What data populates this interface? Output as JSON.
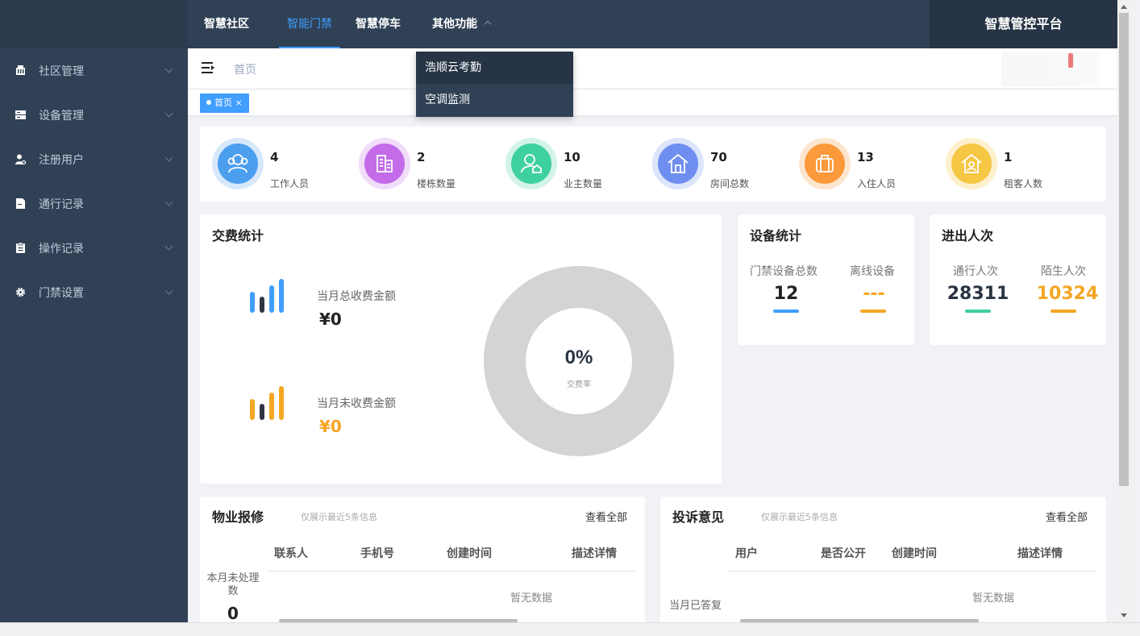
{
  "nav": {
    "tabs": [
      {
        "label": "智慧社区"
      },
      {
        "label": "智能门禁"
      },
      {
        "label": "智慧停车"
      },
      {
        "label": "其他功能"
      }
    ],
    "platform_title": "智慧管控平台",
    "dropdown": [
      "浩顺云考勤",
      "空调监测"
    ]
  },
  "sidebar": {
    "items": [
      {
        "label": "社区管理",
        "icon": "building-icon"
      },
      {
        "label": "设备管理",
        "icon": "server-icon"
      },
      {
        "label": "注册用户",
        "icon": "user-icon"
      },
      {
        "label": "通行记录",
        "icon": "document-icon"
      },
      {
        "label": "操作记录",
        "icon": "clipboard-icon"
      },
      {
        "label": "门禁设置",
        "icon": "gear-icon"
      }
    ]
  },
  "breadcrumb": {
    "home": "首页"
  },
  "tags": {
    "home": "首页 ×"
  },
  "stats": [
    {
      "num": "4",
      "label": "工作人员",
      "color": "#4c9fee"
    },
    {
      "num": "2",
      "label": "楼栋数量",
      "color": "#c36be8"
    },
    {
      "num": "10",
      "label": "业主数量",
      "color": "#3fd0a0"
    },
    {
      "num": "70",
      "label": "房间总数",
      "color": "#6f8ff0"
    },
    {
      "num": "13",
      "label": "入住人员",
      "color": "#fb9a3c"
    },
    {
      "num": "1",
      "label": "租客人数",
      "color": "#f6c744"
    }
  ],
  "fees": {
    "title": "交费统计",
    "collected_label": "当月总收费金额",
    "collected_value": "¥0",
    "uncollected_label": "当月未收费金额",
    "uncollected_value": "¥0",
    "rate": "0%",
    "rate_label": "交费率",
    "rate_value": 0
  },
  "devices": {
    "title": "设备统计",
    "total_label": "门禁设备总数",
    "total_value": "12",
    "offline_label": "离线设备",
    "offline_value": "---"
  },
  "traffic": {
    "title": "进出人次",
    "pass_label": "通行人次",
    "pass_value": "28311",
    "stranger_label": "陌生人次",
    "stranger_value": "10324"
  },
  "repairs": {
    "title": "物业报修",
    "note": "仅展示最近5条信息",
    "view_all": "查看全部",
    "side_label": "本月未处理数",
    "side_value": "0",
    "columns": [
      "联系人",
      "手机号",
      "创建时间",
      "描述详情"
    ],
    "empty": "暂无数据"
  },
  "complaints": {
    "title": "投诉意见",
    "note": "仅展示最近5条信息",
    "view_all": "查看全部",
    "side_label": "当月已答复",
    "columns": [
      "用户",
      "是否公开",
      "创建时间",
      "描述详情"
    ],
    "empty": "暂无数据"
  }
}
